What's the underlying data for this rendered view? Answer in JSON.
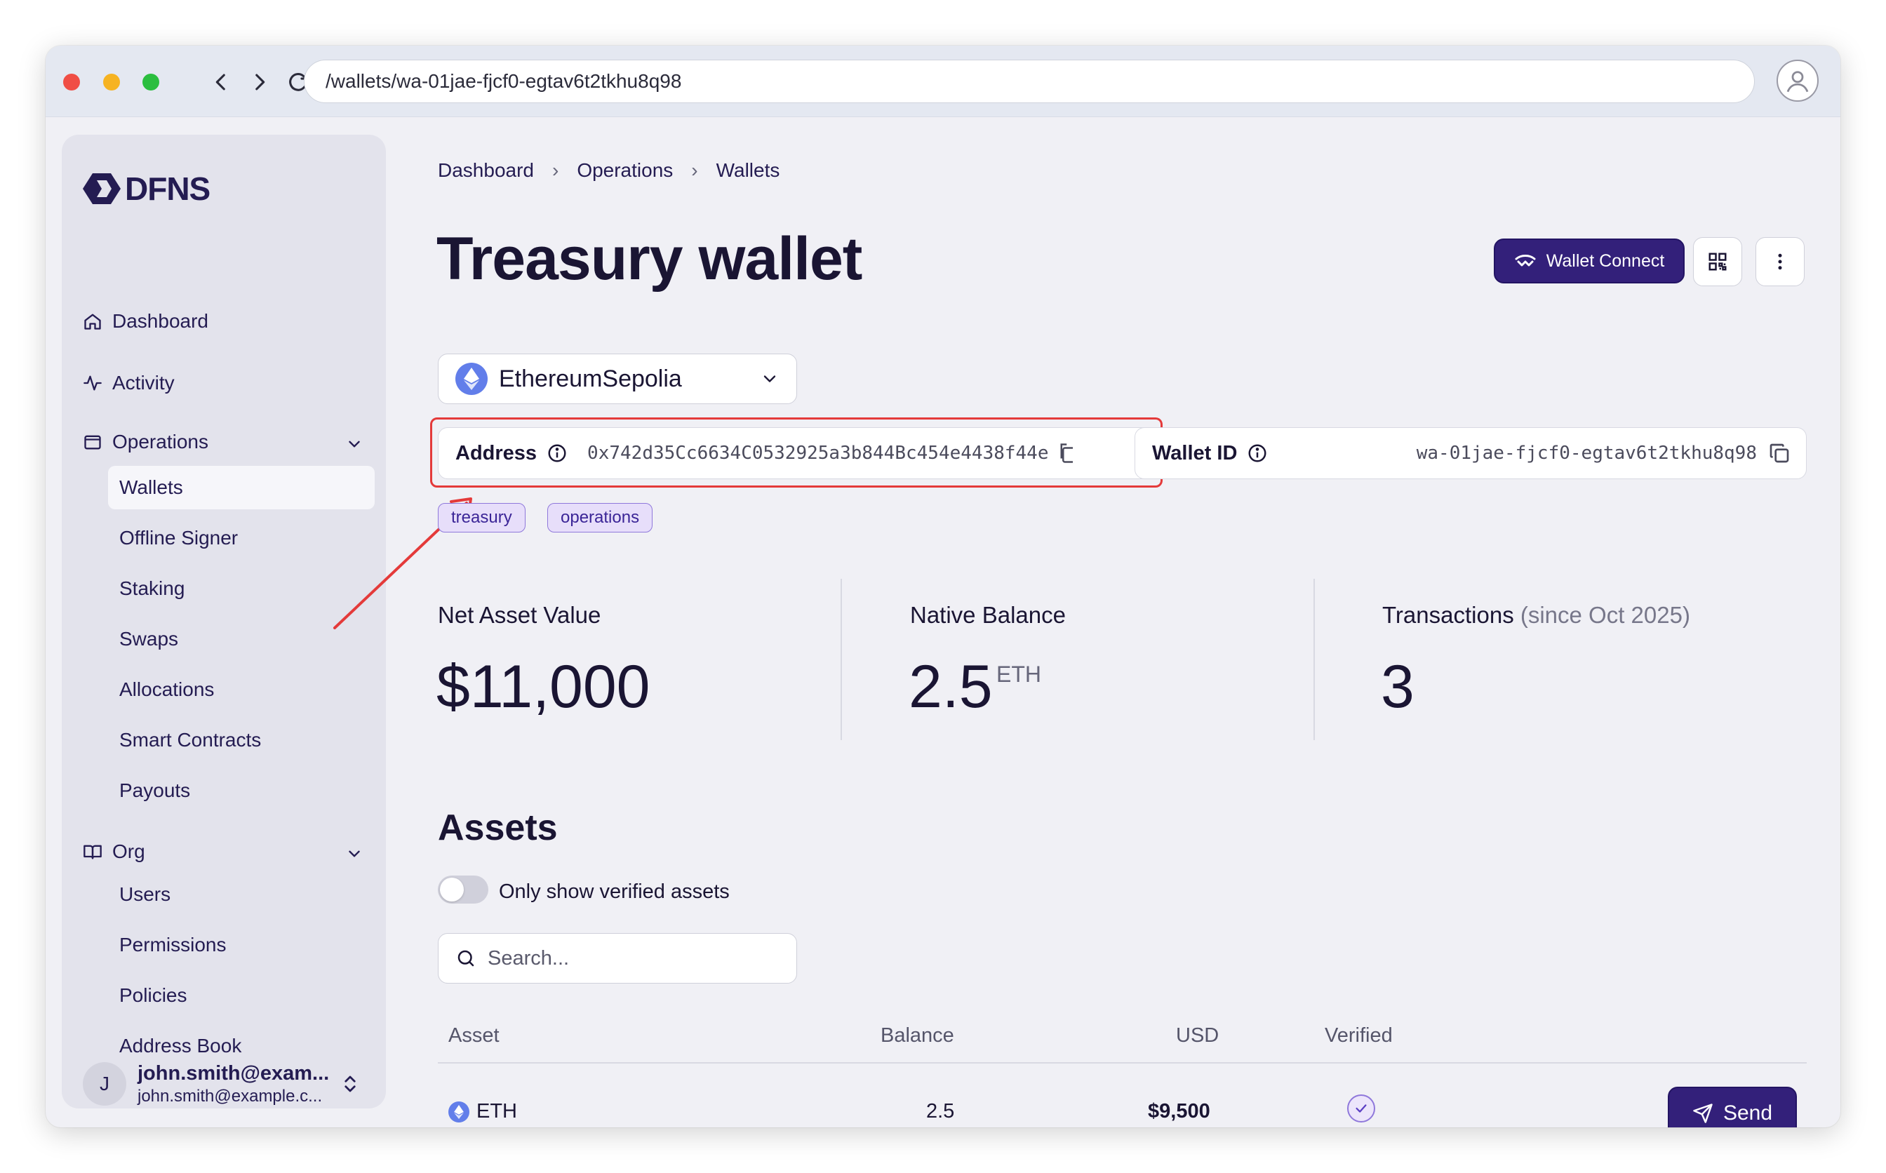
{
  "browser": {
    "url": "/wallets/wa-01jae-fjcf0-egtav6t2tkhu8q98"
  },
  "sidebar": {
    "logo": "DFNS",
    "items": [
      {
        "label": "Dashboard",
        "icon": "home-icon"
      },
      {
        "label": "Activity",
        "icon": "activity-icon"
      },
      {
        "label": "Operations",
        "icon": "wallet-icon"
      }
    ],
    "operations_sub": [
      "Wallets",
      "Offline Signer",
      "Staking",
      "Swaps",
      "Allocations",
      "Smart Contracts",
      "Payouts"
    ],
    "org": {
      "label": "Org",
      "icon": "book-icon"
    },
    "org_sub": [
      "Users",
      "Permissions",
      "Policies",
      "Address Book"
    ],
    "user": {
      "initial": "J",
      "name": "john.smith@exam...",
      "email": "john.smith@example.c..."
    }
  },
  "breadcrumb": [
    "Dashboard",
    "Operations",
    "Wallets"
  ],
  "page": {
    "title": "Treasury wallet",
    "wallet_connect_label": "Wallet Connect"
  },
  "network": {
    "selected": "EthereumSepolia"
  },
  "address": {
    "label": "Address",
    "value": "0x742d35Cc6634C0532925a3b844Bc454e4438f44e"
  },
  "wallet_id": {
    "label": "Wallet ID",
    "value": "wa-01jae-fjcf0-egtav6t2tkhu8q98"
  },
  "tags": [
    "treasury",
    "operations"
  ],
  "stats": {
    "nav_label": "Net Asset Value",
    "nav_value": "$11,000",
    "native_label": "Native Balance",
    "native_value": "2.5",
    "native_unit": "ETH",
    "tx_label": "Transactions",
    "tx_since": "(since Oct 2025)",
    "tx_value": "3"
  },
  "assets": {
    "title": "Assets",
    "toggle_label": "Only show verified assets",
    "toggle_on": false,
    "search_placeholder": "Search...",
    "columns": [
      "Asset",
      "Balance",
      "USD",
      "Verified"
    ],
    "rows": [
      {
        "asset": "ETH",
        "balance": "2.5",
        "usd": "$9,500",
        "verified": true,
        "action": "Send"
      }
    ]
  },
  "colors": {
    "accent": "#33207a",
    "highlight": "#e43a3a",
    "tag_bg": "#e7defa",
    "eth": "#627eea"
  }
}
